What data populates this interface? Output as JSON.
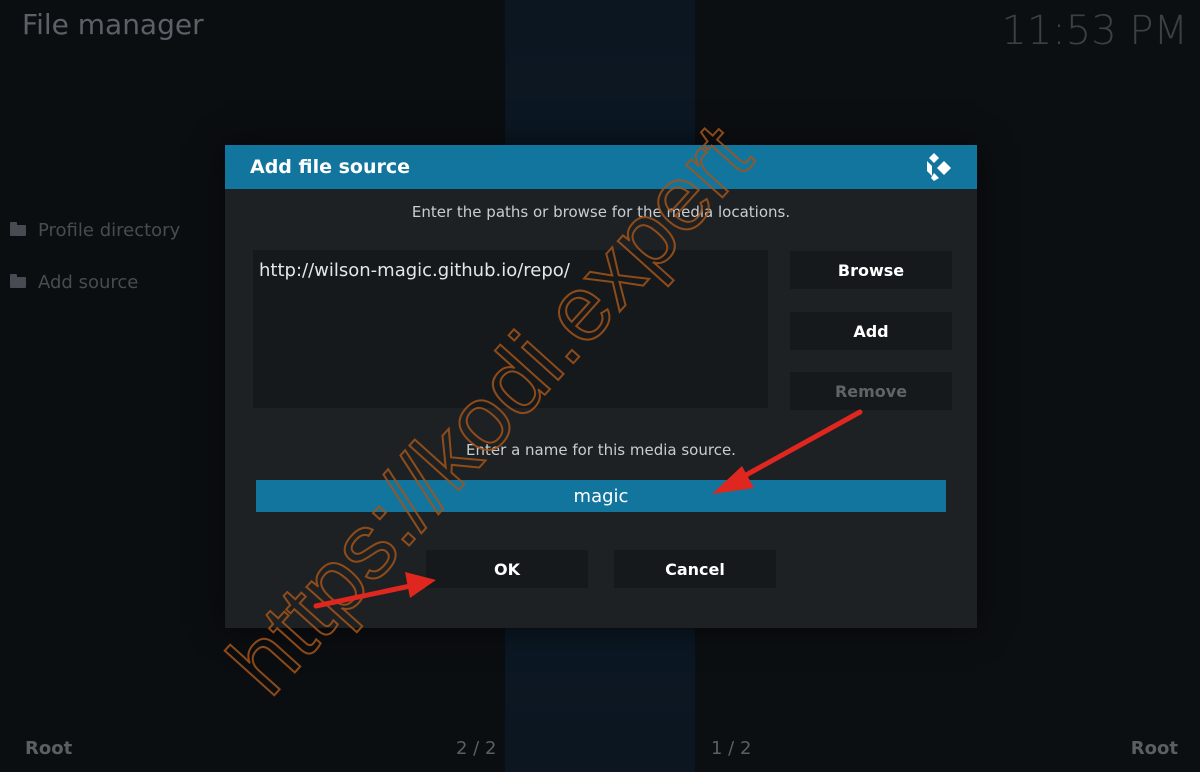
{
  "header": {
    "title": "File manager",
    "clock": "11:53 PM"
  },
  "sidebar": {
    "items": [
      {
        "label": "Profile directory"
      },
      {
        "label": "Add source"
      }
    ]
  },
  "footer": {
    "left_label": "Root",
    "left_page": "2 / 2",
    "right_page": "1 / 2",
    "right_label": "Root"
  },
  "dialog": {
    "title": "Add file source",
    "paths_instruction": "Enter the paths or browse for the media locations.",
    "paths": [
      "http://wilson-magic.github.io/repo/"
    ],
    "browse_label": "Browse",
    "add_label": "Add",
    "remove_label": "Remove",
    "name_instruction": "Enter a name for this media source.",
    "name_value": "magic",
    "ok_label": "OK",
    "cancel_label": "Cancel"
  },
  "watermark": {
    "text": "https://kodi.expert"
  },
  "colors": {
    "accent": "#12759e",
    "dialog_bg": "#1d2124",
    "button_bg": "#15191b",
    "arrow": "#e0271f",
    "watermark": "#a4541a"
  }
}
